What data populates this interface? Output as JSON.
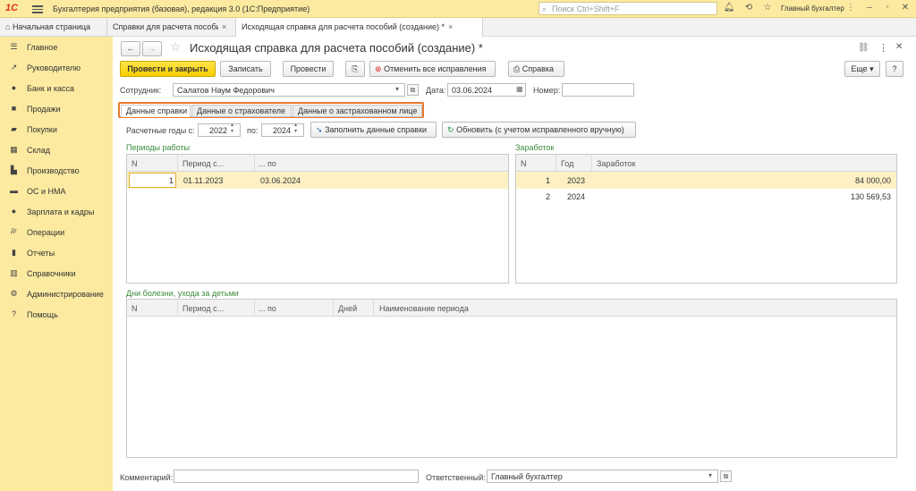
{
  "app": {
    "logo": "1С",
    "title": "Бухгалтерия предприятия (базовая), редакция 3.0  (1С:Предприятие)",
    "search_placeholder": "Поиск Ctrl+Shift+F",
    "user": "Главный бухгалтер"
  },
  "tabs": [
    {
      "label": "Начальная страница"
    },
    {
      "label": "Справки для расчета пособий (исх.)",
      "close": "×"
    },
    {
      "label": "Исходящая справка для расчета пособий (создание) *",
      "close": "×"
    }
  ],
  "sidebar": {
    "items": [
      {
        "label": "Главное",
        "icon": "menu-icon"
      },
      {
        "label": "Руководителю",
        "icon": "chart-icon"
      },
      {
        "label": "Банк и касса",
        "icon": "bank-icon"
      },
      {
        "label": "Продажи",
        "icon": "bag-icon"
      },
      {
        "label": "Покупки",
        "icon": "cart-icon"
      },
      {
        "label": "Склад",
        "icon": "warehouse-icon"
      },
      {
        "label": "Производство",
        "icon": "factory-icon"
      },
      {
        "label": "ОС и НМА",
        "icon": "truck-icon"
      },
      {
        "label": "Зарплата и кадры",
        "icon": "person-icon"
      },
      {
        "label": "Операции",
        "icon": "operations-icon"
      },
      {
        "label": "Отчеты",
        "icon": "report-icon"
      },
      {
        "label": "Справочники",
        "icon": "book-icon"
      },
      {
        "label": "Администрирование",
        "icon": "gear-icon"
      },
      {
        "label": "Помощь",
        "icon": "help-icon"
      }
    ]
  },
  "doc": {
    "title": "Исходящая справка для расчета пособий (создание) *",
    "buttons": {
      "post_close": "Провести и закрыть",
      "save": "Записать",
      "post": "Провести",
      "cancel_corrections": "Отменить все исправления",
      "certificate": "Справка",
      "more": "Еще",
      "help": "?"
    },
    "employee_label": "Сотрудник:",
    "employee_value": "Салатов Наум Федорович",
    "date_label": "Дата:",
    "date_value": "03.06.2024",
    "number_label": "Номер:",
    "number_value": ""
  },
  "form_tabs": [
    "Данные справки",
    "Данные о страхователе",
    "Данные о застрахованном лице"
  ],
  "years": {
    "label_from": "Расчетные годы с:",
    "from": "2022",
    "label_to": "по:",
    "to": "2024",
    "fill_button": "Заполнить данные справки",
    "refresh_button": "Обновить (с учетом исправленного вручную)"
  },
  "work_periods": {
    "title": "Периоды работы",
    "columns": [
      "N",
      "Период с...",
      "... по"
    ],
    "rows": [
      {
        "n": "1",
        "from": "01.11.2023",
        "to": "03.06.2024"
      }
    ]
  },
  "earnings": {
    "title": "Заработок",
    "columns": [
      "N",
      "Год",
      "Заработок"
    ],
    "rows": [
      {
        "n": "1",
        "year": "2023",
        "amount": "84 000,00"
      },
      {
        "n": "2",
        "year": "2024",
        "amount": "130 569,53"
      }
    ]
  },
  "sick_days": {
    "title": "Дни болезни, ухода за детьми",
    "columns": [
      "N",
      "Период с...",
      "... по",
      "Дней",
      "Наименование периода"
    ]
  },
  "footer": {
    "comment_label": "Комментарий:",
    "comment_value": "",
    "responsible_label": "Ответственный:",
    "responsible_value": "Главный бухгалтер"
  },
  "colors": {
    "brand_yellow": "#fbeaa0",
    "primary_button": "#f7cd00",
    "tab_highlight": "#e87a2c",
    "group_title": "#3a8a3a"
  }
}
